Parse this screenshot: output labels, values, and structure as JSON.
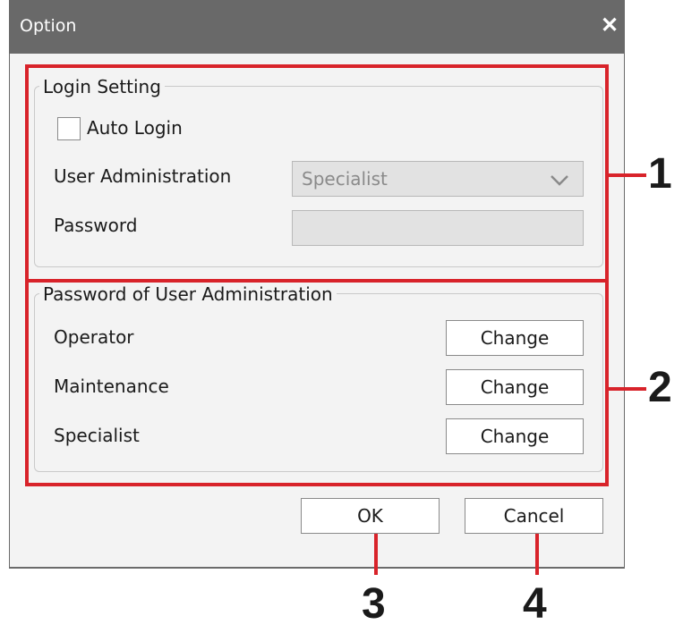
{
  "window": {
    "title": "Option",
    "close_glyph": "✕"
  },
  "login_setting": {
    "legend": "Login Setting",
    "auto_login_label": "Auto Login",
    "auto_login_checked": false,
    "user_admin_label": "User Administration",
    "user_admin_value": "Specialist",
    "password_label": "Password",
    "password_value": ""
  },
  "password_admin": {
    "legend": "Password of User Administration",
    "rows": [
      {
        "label": "Operator",
        "button": "Change"
      },
      {
        "label": "Maintenance",
        "button": "Change"
      },
      {
        "label": "Specialist",
        "button": "Change"
      }
    ]
  },
  "footer": {
    "ok_label": "OK",
    "cancel_label": "Cancel"
  },
  "callouts": [
    "1",
    "2",
    "3",
    "4"
  ],
  "colors": {
    "titlebar": "#696969",
    "dialog_body": "#f3f3f3",
    "annotation_red": "#d8232a",
    "disabled_field": "#e2e2e2"
  }
}
